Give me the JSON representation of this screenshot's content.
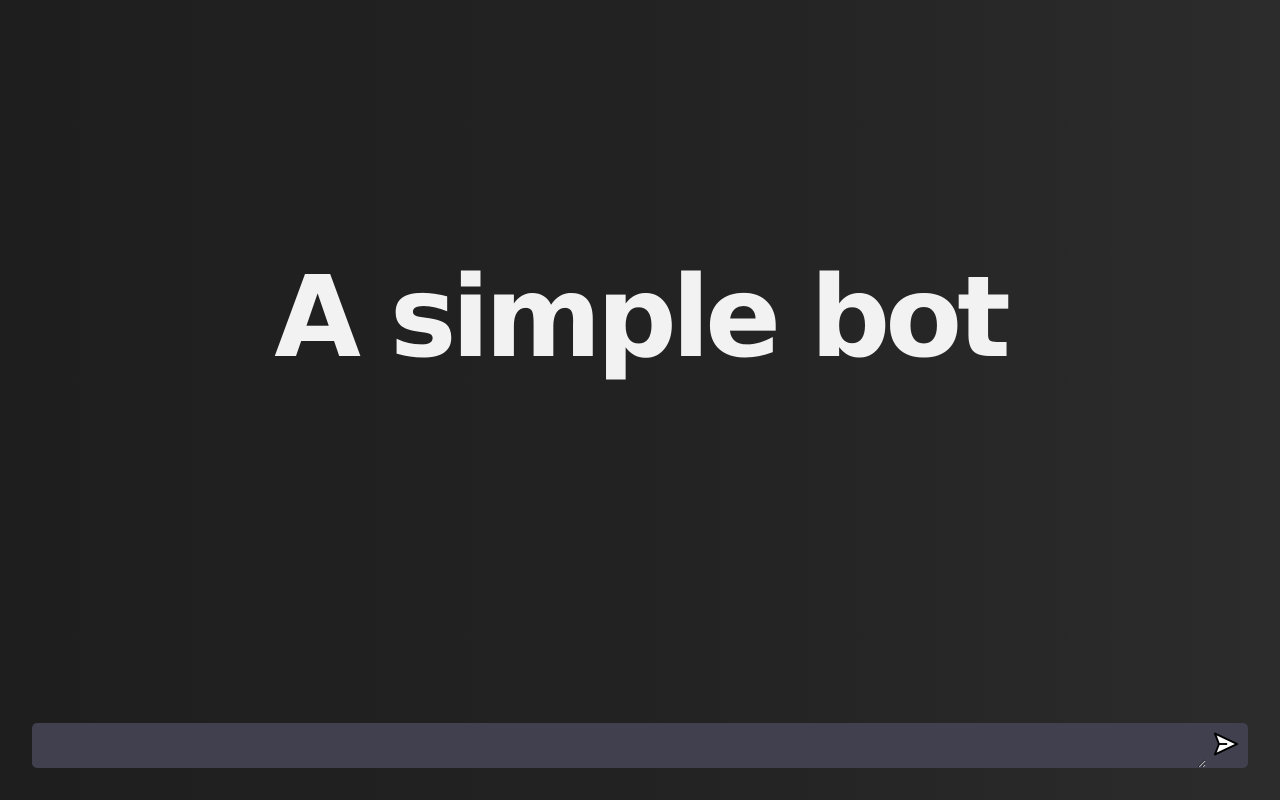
{
  "hero": {
    "title": "A simple bot"
  },
  "composer": {
    "value": "",
    "placeholder": "",
    "send_icon": "send-icon"
  },
  "colors": {
    "background": "#222222",
    "title": "#f2f2f2",
    "input_background": "#40404f"
  }
}
